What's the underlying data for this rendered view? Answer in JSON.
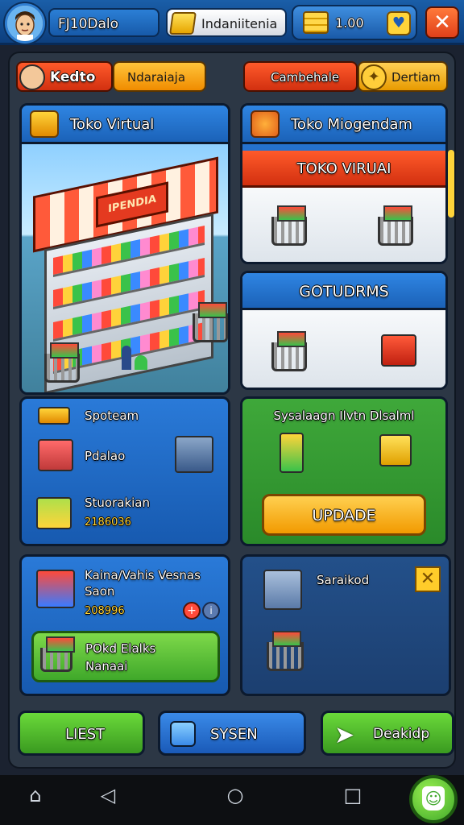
{
  "topbar": {
    "title": "FJ10Dalo",
    "resource_label": "Indaniitenia",
    "coin_value": "1.00",
    "heart_icon": "heart-icon",
    "close_icon": "close-icon"
  },
  "row2": {
    "player_label": "Kedto",
    "orange_label": "Ndaraiaja",
    "red_label": "Cambehale",
    "gold_label": "Dertiam"
  },
  "panels": {
    "store": {
      "title": "Toko Virtual",
      "sign": "IPENDIA"
    },
    "stock": {
      "title": "Toko Miogendam",
      "sub1_title": "TOKO VIRUAI",
      "sub2_title": "GOTUDRMS"
    },
    "stats": {
      "label1": "Spoteam",
      "label2": "Pdalao",
      "label3": "Stuorakian",
      "value3": "2186036"
    },
    "upgrade": {
      "title": "Sysalaagn Ilvtn Dlsalml",
      "button": "UPDADE"
    },
    "sales": {
      "label1": "Kaina/Vahis Vesnas",
      "label2": "Saon",
      "value": "208996",
      "button_line1": "POkd Elalks",
      "button_line2": "Nanaai"
    },
    "storage": {
      "label": "Saraikod"
    }
  },
  "bottom_buttons": {
    "left": "LIEST",
    "middle": "SYSEN",
    "right": "Deakidp"
  },
  "colors": {
    "primary_blue": "#2a7ad8",
    "accent_orange": "#f29a00",
    "accent_red": "#d23010",
    "accent_green": "#3fa82a"
  }
}
